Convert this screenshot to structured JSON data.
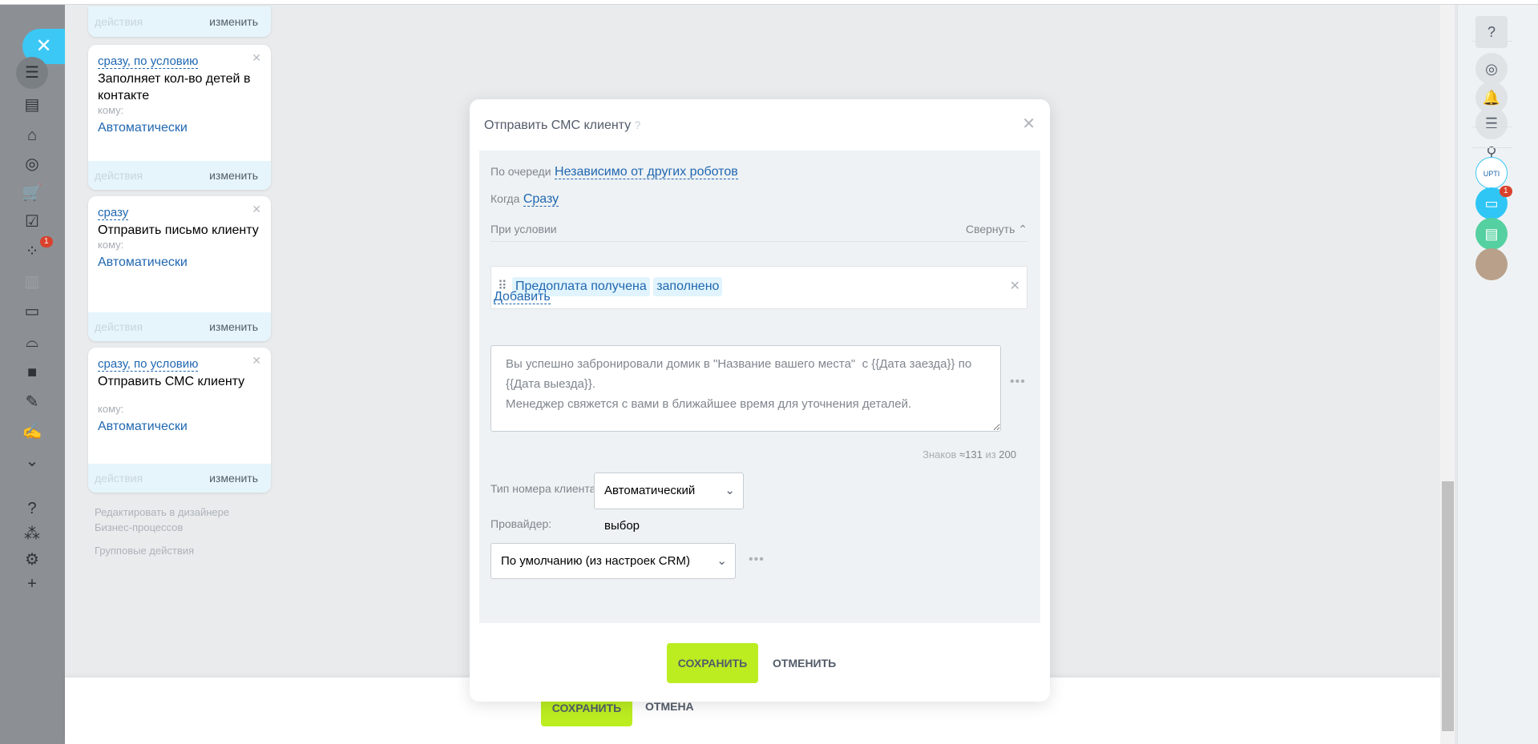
{
  "cards": [
    {
      "footer_actions": "действия",
      "footer_edit": "изменить"
    },
    {
      "when": "сразу, по условию",
      "title": "Заполняет кол-во детей в контакте",
      "to_label": "кому:",
      "to_value": "Автоматически",
      "footer_actions": "действия",
      "footer_edit": "изменить"
    },
    {
      "when": "сразу",
      "title": "Отправить письмо клиенту",
      "to_label": "кому:",
      "to_value": "Автоматически",
      "footer_actions": "действия",
      "footer_edit": "изменить"
    },
    {
      "when": "сразу, по условию",
      "title": "Отправить СМС клиенту",
      "to_label": "кому:",
      "to_value": "Автоматически",
      "footer_actions": "действия",
      "footer_edit": "изменить"
    }
  ],
  "links": {
    "designer": "Редактировать в дизайнере Бизнес-процессов",
    "group": "Групповые действия"
  },
  "left_nav": {
    "badge": "1"
  },
  "bottom_bar": {
    "save": "СОХРАНИТЬ",
    "cancel": "ОТМЕНА"
  },
  "right_panel": {
    "chat_badge": "1",
    "upti_label": "UPTI"
  },
  "dialog": {
    "title": "Отправить СМС клиенту",
    "queue_label": "По очереди",
    "queue_value": "Независимо от других роботов",
    "when_label": "Когда",
    "when_value": "Сразу",
    "condition_label": "При условии",
    "collapse": "Свернуть",
    "condition_field": "Предоплата получена",
    "condition_op": "заполнено",
    "add": "Добавить",
    "message": "Вы успешно забронировали домик в \"Название вашего места\"  с {{Дата заезда}} по {{Дата выезда}}.\nМенеджер свяжется с вами в ближайшее время для уточнения деталей.",
    "chars_label": "Знаков",
    "chars_count": "≈131",
    "chars_of": "из",
    "chars_max": "200",
    "phone_type_label": "Тип номера клиента:",
    "phone_type_value": "Автоматический выбор",
    "provider_label": "Провайдер:",
    "provider_value": "По умолчанию (из настроек CRM)",
    "save": "СОХРАНИТЬ",
    "cancel": "ОТМЕНИТЬ"
  }
}
